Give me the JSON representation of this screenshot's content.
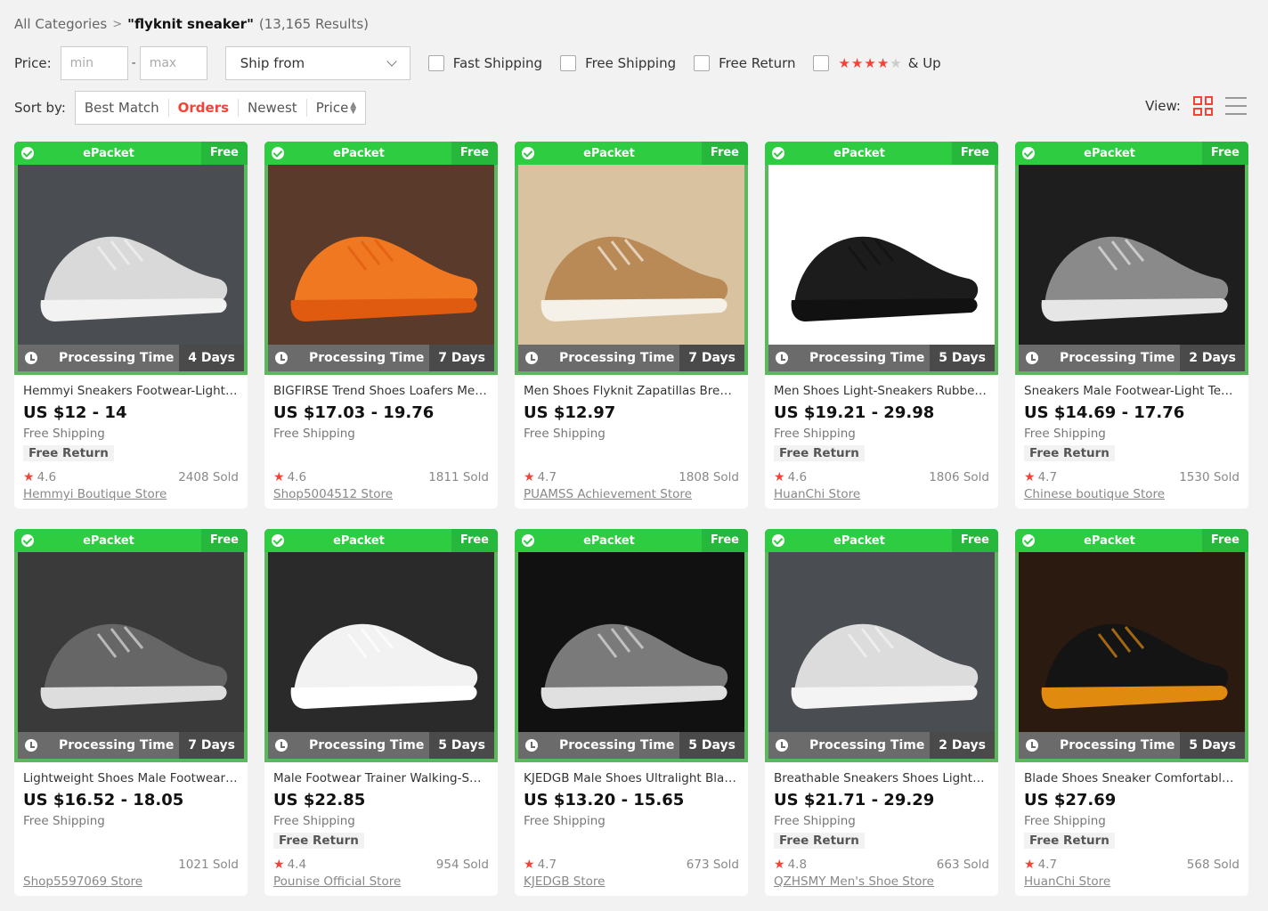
{
  "breadcrumb": {
    "root": "All Categories",
    "sep": ">",
    "query": "\"flyknit sneaker\"",
    "count": "(13,165 Results)"
  },
  "filters": {
    "price_label": "Price:",
    "min_placeholder": "min",
    "max_placeholder": "max",
    "dash": "-",
    "ship_from": "Ship from",
    "fast_shipping": "Fast Shipping",
    "free_shipping": "Free Shipping",
    "free_return": "Free Return",
    "stars_on": "★★★★",
    "stars_off": "★",
    "and_up": "& Up"
  },
  "sort": {
    "label": "Sort by:",
    "best_match": "Best Match",
    "orders": "Orders",
    "newest": "Newest",
    "price": "Price"
  },
  "view": {
    "label": "View:"
  },
  "colors": {
    "accent": "#f44336",
    "epacket": "#2ecc40",
    "frame": "#5cb85c"
  },
  "products": [
    {
      "epacket": "ePacket",
      "free": "Free",
      "ptime_label": "Processing Time",
      "days": "4 Days",
      "title": "Hemmyi Sneakers Footwear-Light Men Shoes Breathable",
      "price": "US $12 - 14",
      "shipping": "Free Shipping",
      "ret": "Free Return",
      "rating": "4.6",
      "sold": "2408 Sold",
      "store": "Hemmyi Boutique Store",
      "bg": "#4a4d52",
      "shoe": "#d9d9d9",
      "sole": "#f2f2f2"
    },
    {
      "epacket": "ePacket",
      "free": "Free",
      "ptime_label": "Processing Time",
      "days": "7 Days",
      "title": "BIGFIRSE Trend Shoes Loafers Men Sneakers",
      "price": "US $17.03 - 19.76",
      "shipping": "Free Shipping",
      "ret": "",
      "rating": "4.6",
      "sold": "1811 Sold",
      "store": "Shop5004512 Store",
      "bg": "#5a3a2a",
      "shoe": "#f07820",
      "sole": "#e05a10"
    },
    {
      "epacket": "ePacket",
      "free": "Free",
      "ptime_label": "Processing Time",
      "days": "7 Days",
      "title": "Men Shoes Flyknit Zapatillas Breathable Sneakers",
      "price": "US $12.97",
      "shipping": "Free Shipping",
      "ret": "",
      "rating": "4.7",
      "sold": "1808 Sold",
      "store": "PUAMSS Achievement Store",
      "bg": "#d9c2a0",
      "shoe": "#b98a56",
      "sole": "#f5f0e8"
    },
    {
      "epacket": "ePacket",
      "free": "Free",
      "ptime_label": "Processing Time",
      "days": "5 Days",
      "title": "Men Shoes Light-Sneakers Rubber Breathable Running",
      "price": "US $19.21 - 29.98",
      "shipping": "Free Shipping",
      "ret": "Free Return",
      "rating": "4.6",
      "sold": "1806 Sold",
      "store": "HuanChi Store",
      "bg": "#ffffff",
      "shoe": "#1c1c1c",
      "sole": "#111111"
    },
    {
      "epacket": "ePacket",
      "free": "Free",
      "ptime_label": "Processing Time",
      "days": "2 Days",
      "title": "Sneakers Male Footwear-Light Tennis Men Shoes",
      "price": "US $14.69 - 17.76",
      "shipping": "Free Shipping",
      "ret": "Free Return",
      "rating": "4.7",
      "sold": "1530 Sold",
      "store": "Chinese boutique Store",
      "bg": "#1e1e1e",
      "shoe": "#8a8a8a",
      "sole": "#e6e6e6"
    },
    {
      "epacket": "ePacket",
      "free": "Free",
      "ptime_label": "Processing Time",
      "days": "7 Days",
      "title": "Lightweight Shoes Male Footwear Sneakers Men",
      "price": "US $16.52 - 18.05",
      "shipping": "Free Shipping",
      "ret": "",
      "rating": "",
      "sold": "1021 Sold",
      "store": "Shop5597069 Store",
      "bg": "#3a3a3a",
      "shoe": "#666666",
      "sole": "#dddddd"
    },
    {
      "epacket": "ePacket",
      "free": "Free",
      "ptime_label": "Processing Time",
      "days": "5 Days",
      "title": "Male Footwear Trainer Walking-Sneakers Men Shoes",
      "price": "US $22.85",
      "shipping": "Free Shipping",
      "ret": "Free Return",
      "rating": "4.4",
      "sold": "954 Sold",
      "store": "Pounise Official Store",
      "bg": "#2a2a2a",
      "shoe": "#f2f2f2",
      "sole": "#ffffff"
    },
    {
      "epacket": "ePacket",
      "free": "Free",
      "ptime_label": "Processing Time",
      "days": "5 Days",
      "title": "KJEDGB Male Shoes Ultralight Black Sneakers",
      "price": "US $13.20 - 15.65",
      "shipping": "Free Shipping",
      "ret": "",
      "rating": "4.7",
      "sold": "673 Sold",
      "store": "KJEDGB Store",
      "bg": "#111111",
      "shoe": "#7a7a7a",
      "sole": "#e0e0e0"
    },
    {
      "epacket": "ePacket",
      "free": "Free",
      "ptime_label": "Processing Time",
      "days": "2 Days",
      "title": "Breathable Sneakers Shoes Lightweight Men Footwear",
      "price": "US $21.71 - 29.29",
      "shipping": "Free Shipping",
      "ret": "Free Return",
      "rating": "4.8",
      "sold": "663 Sold",
      "store": "QZHSMY Men's Shoe Store",
      "bg": "#4a4d52",
      "shoe": "#dcdcdc",
      "sole": "#f4f4f4"
    },
    {
      "epacket": "ePacket",
      "free": "Free",
      "ptime_label": "Processing Time",
      "days": "5 Days",
      "title": "Blade Shoes Sneaker Comfortable Men Running",
      "price": "US $27.69",
      "shipping": "Free Shipping",
      "ret": "Free Return",
      "rating": "4.7",
      "sold": "568 Sold",
      "store": "HuanChi Store",
      "bg": "#2a1a10",
      "shoe": "#141414",
      "sole": "#e08a10"
    }
  ]
}
